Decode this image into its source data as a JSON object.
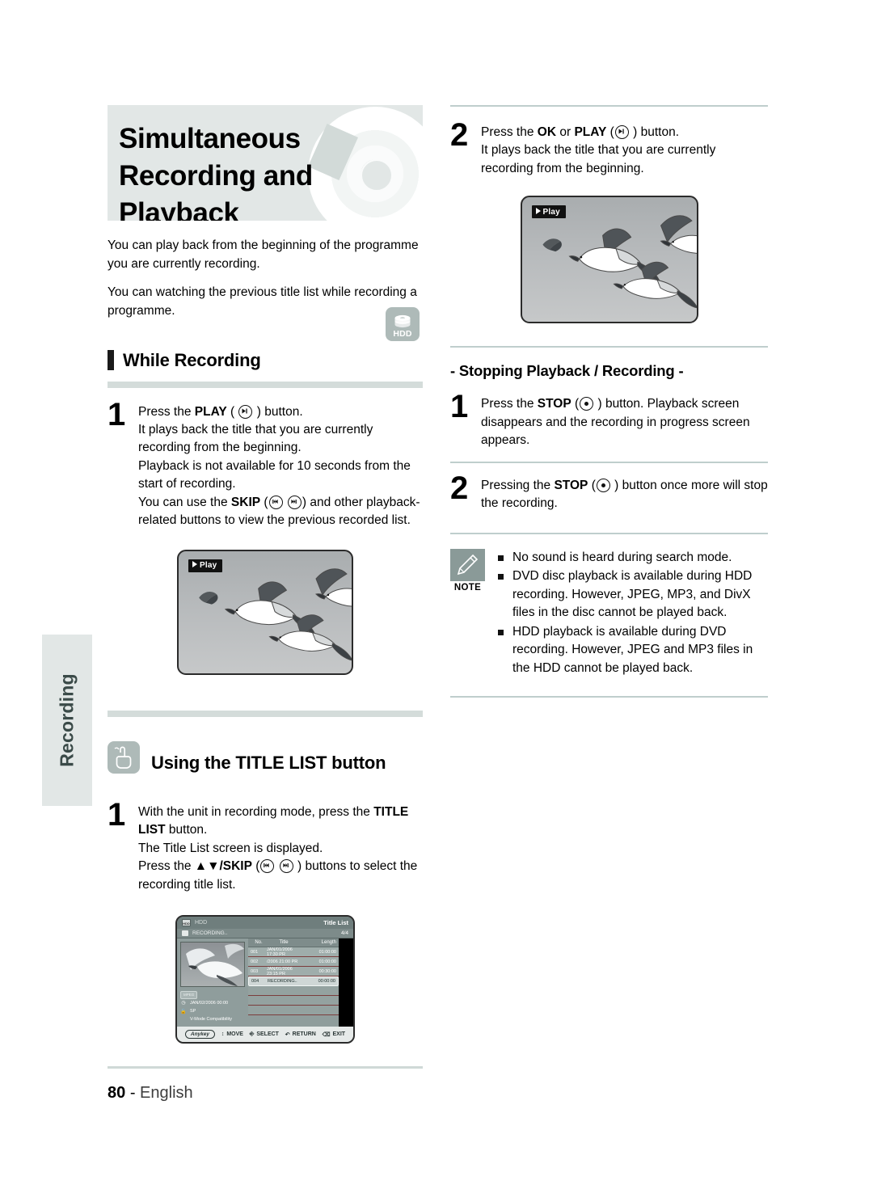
{
  "side_tab": {
    "label": "Recording"
  },
  "banner": {
    "title_line1": "Simultaneous",
    "title_line2": "Recording and Playback",
    "disc_icon": "dvd-disc-icon"
  },
  "intro": {
    "para1": "You can play back from the beginning of the programme you are currently recording.",
    "para2": "You can watching the previous title list while recording a programme."
  },
  "hdd_badge": {
    "label": "HDD"
  },
  "left_column": {
    "section_while_recording": {
      "heading": "While Recording",
      "step": {
        "number": "1",
        "line1_pre": "Press the ",
        "line1_bold": "PLAY",
        "line1_mid": " ( ",
        "line1_post": " ) button.",
        "line2": "It plays back the title that you are currently recording from the beginning.",
        "line3": "Playback is not available for 10 seconds from the start of recording.",
        "line4_pre": "You can use the ",
        "line4_bold": "SKIP",
        "line4_post": ") and other playback-related buttons to view the previous recorded list."
      },
      "photo": {
        "play_badge": "Play",
        "alt": "seagulls-flying-photo"
      }
    },
    "section_title_list": {
      "heading": "Using the TITLE LIST button",
      "icon": "hand-press-icon",
      "step": {
        "number": "1",
        "line1_pre": "With the unit in recording mode, press the ",
        "line1_bold": "TITLE LIST",
        "line1_post": " button.",
        "line2": "The Title List screen is displayed.",
        "line3_pre": "Press the ",
        "line3_bold": "▲▼/SKIP",
        "line3_post": " ) buttons to select the recording title list."
      }
    }
  },
  "right_column": {
    "step2": {
      "number": "2",
      "line1_pre": "Press the ",
      "line1_bold1": "OK",
      "line1_mid": " or ",
      "line1_bold2": "PLAY",
      "line1_post": " ) button.",
      "line2": "It plays back the title that you are currently recording from the beginning."
    },
    "photo": {
      "play_badge": "Play",
      "alt": "seagulls-flying-photo"
    },
    "section_stopping": {
      "heading": "- Stopping Playback / Recording -",
      "steps": [
        {
          "number": "1",
          "pre": "Press the ",
          "bold": "STOP",
          "post": " ) button. Playback screen disappears and the recording in progress screen appears."
        },
        {
          "number": "2",
          "pre": "Pressing the ",
          "bold": "STOP",
          "post": " ) button once more will stop the recording."
        }
      ]
    },
    "note": {
      "label": "NOTE",
      "icon": "pencil-icon",
      "items": [
        "No sound is heard during search mode.",
        "DVD disc playback is available during HDD recording. However, JPEG, MP3, and DivX files in the disc cannot be played back.",
        "HDD playback is available during DVD recording. However, JPEG and MP3 files in the HDD cannot be played back."
      ]
    }
  },
  "osd": {
    "device_label": "HDD",
    "screen_title": "Title List",
    "status_text": "RECORDING..",
    "page_count": "4/4",
    "columns": {
      "no": "No.",
      "title": "Title",
      "length": "Length"
    },
    "rows": [
      {
        "no": "001",
        "title": "JAN/01/2006 17:30 PR",
        "length": "01:00:00",
        "selected": false
      },
      {
        "no": "002",
        "title": "/2006 21:00 PR",
        "length": "01:00:00",
        "selected": false
      },
      {
        "no": "003",
        "title": "JAN/01/2006 23:15 PR",
        "length": "00:30:00",
        "selected": false
      },
      {
        "no": "004",
        "title": "RECORDING..",
        "length": "00:00:00",
        "selected": true
      }
    ],
    "info": {
      "format_badge": "MPEG",
      "date": "JAN/02/2006 00:00",
      "lock_icon": "unlock-icon",
      "mode": "SP",
      "compat": "V-Mode Compatibility"
    },
    "footer": {
      "anykey": "Anykey",
      "move": "MOVE",
      "select": "SELECT",
      "return": "RETURN",
      "exit": "EXIT"
    }
  },
  "footer": {
    "page_number": "80",
    "dash": "-",
    "language": "English"
  },
  "colors": {
    "banner_bg": "#e2e7e6",
    "rule_thick": "#d4dcda",
    "rule_thin": "#bfcecd",
    "badge_grey": "#aebab8",
    "note_icon": "#8a9a98"
  }
}
